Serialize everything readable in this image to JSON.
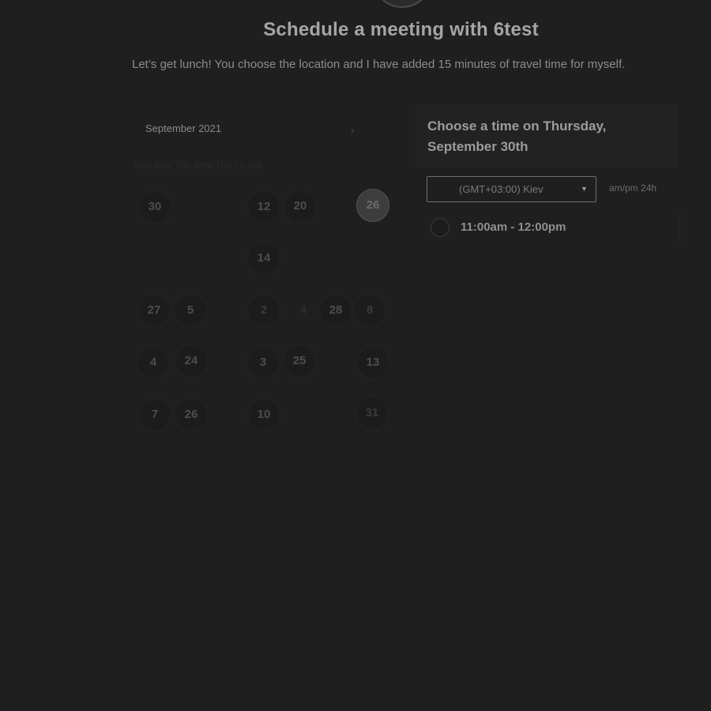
{
  "header": {
    "title": "Schedule a meeting with 6test",
    "subtitle": "Let’s get lunch! You choose the location and I have added 15 minutes of travel time for myself."
  },
  "calendar": {
    "month_label": "September 2021",
    "next_icon": "chevron-right-icon",
    "weekdays": "Sun  Mon  Tue  Wed  Thu  Fri  Sat",
    "days": [
      {
        "label": "30"
      },
      {
        "label": "12"
      },
      {
        "label": "20"
      },
      {
        "label": "26",
        "selected": true
      },
      {
        "label": "14"
      },
      {
        "label": "27"
      },
      {
        "label": "5"
      },
      {
        "label": "2"
      },
      {
        "label": "4"
      },
      {
        "label": "28"
      },
      {
        "label": "8"
      },
      {
        "label": "4"
      },
      {
        "label": "24"
      },
      {
        "label": "3"
      },
      {
        "label": "25"
      },
      {
        "label": "13"
      },
      {
        "label": "7"
      },
      {
        "label": "26"
      },
      {
        "label": "10"
      },
      {
        "label": "31"
      }
    ]
  },
  "time_panel": {
    "heading": "Choose a time on Thursday, September 30th",
    "timezone_value": "(GMT+03:00) Kiev",
    "caret_icon": "caret-down-icon",
    "format_ampm": "am/pm",
    "format_24h": "24h",
    "slots": [
      {
        "label": "11:00am - 12:00pm"
      }
    ]
  }
}
